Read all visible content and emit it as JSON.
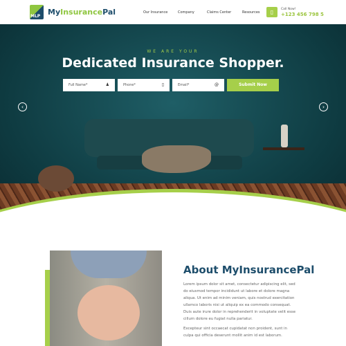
{
  "header": {
    "logo_text": "MLP",
    "brand_my": "My",
    "brand_insurance": "Insurance",
    "brand_pal": "Pal",
    "nav": [
      "Our Insurance",
      "Company",
      "Claims Center",
      "Resources"
    ],
    "call_label": "Call Now!",
    "phone": "+123 456 798 5"
  },
  "hero": {
    "tagline": "WE ARE YOUR",
    "title": "Dedicated Insurance Shopper.",
    "fields": [
      {
        "placeholder": "Full Name*",
        "icon": "user-icon"
      },
      {
        "placeholder": "Phone*",
        "icon": "phone-icon"
      },
      {
        "placeholder": "Email*",
        "icon": "at-icon"
      }
    ],
    "submit": "Submit Now",
    "prev": "‹",
    "next": "›"
  },
  "about": {
    "title": "About MyInsurancePal",
    "p1": "Lorem ipsum dolor sit amet, consectetur adipiscing elit, sed do eiusmod tempor incididunt ut labore et dolore magna aliqua. Ut enim ad minim veniam, quis nostrud exercitation ullamco laboris nisi ut aliquip ex ea commodo consequat. Duis aute irure dolor in reprehenderit in voluptate velit esse cillum dolore eu fugiat nulla pariatur.",
    "p2": "Excepteur sint occaecat cupidatat non proident, sunt in culpa qui officia deserunt mollit anim id est laborum."
  },
  "colors": {
    "accent": "#a6cf4a",
    "brand": "#1d4d6b"
  }
}
